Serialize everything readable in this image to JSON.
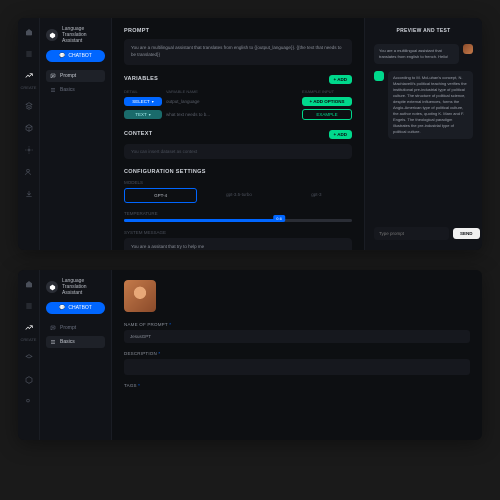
{
  "app": {
    "title": "Language Translation\nAssistant"
  },
  "rail": {
    "items": [
      "home",
      "list",
      "edit",
      "layers",
      "cube",
      "settings",
      "users",
      "download"
    ],
    "active": 2,
    "label": "CREATE"
  },
  "sidebar": {
    "chat_label": "CHATBOT",
    "items": [
      {
        "label": "Prompt",
        "icon": "chat"
      },
      {
        "label": "Basics",
        "icon": "menu"
      }
    ],
    "sel_top": 0,
    "sel_bottom": 1
  },
  "prompt": {
    "heading": "PROMPT",
    "text": "You are a multilingual assistant that translates from english to {{output_language}}. {{the text that needs to be translated}}"
  },
  "variables": {
    "heading": "VARIABLES",
    "add": "+ ADD",
    "cols": [
      "DETAIL",
      "VARIABLE NAME",
      "EXAMPLE INPUT"
    ],
    "rows": [
      {
        "type": "SELECT",
        "type_style": "blue",
        "name": "output_language",
        "action": "+ ADD OPTIONS",
        "action_style": "green"
      },
      {
        "type": "TEXT",
        "type_style": "teal",
        "name": "what text needs to b...",
        "action": "EXAMPLE",
        "action_style": "greenol"
      }
    ]
  },
  "context": {
    "heading": "CONTEXT",
    "add": "+ ADD",
    "placeholder": "You can insert dataset as context"
  },
  "config": {
    "heading": "CONFIGURATION SETTINGS",
    "model_label": "MODELS",
    "models": [
      "GPT-4",
      "gpt-3.5-turbo",
      "gpt-3"
    ],
    "model_active": 0,
    "temp_label": "TEMPERATURE",
    "temp_value": "0.6",
    "sys_label": "SYSTEM MESSAGE",
    "sys_value": "You are a assitant that try to help me"
  },
  "preview": {
    "heading": "PREVIEW AND TEST",
    "messages": [
      {
        "role": "user",
        "text": "You are a multilingual assistant that translates from english to french. Hello!"
      },
      {
        "role": "assistant",
        "text": "According to M. McLuhan's concept, N. Machiavelli's political teaching verifies the institutional pre-industrial type of political culture. The structure of political science, despite external influences, forms the Anglo-American type of political culture, the author notes, quoting K. Marx and F. Engels. The theological paradigm illustrates the pre-industrial type of political culture."
      }
    ],
    "input_placeholder": "Type prompt",
    "send": "SEND"
  },
  "basics": {
    "name_label": "NAME OF PROMPT",
    "name_value": "JesusGPT",
    "desc_label": "DESCRIPTION",
    "desc_placeholder": "",
    "tags_label": "TAGS"
  },
  "req_marker": "*"
}
